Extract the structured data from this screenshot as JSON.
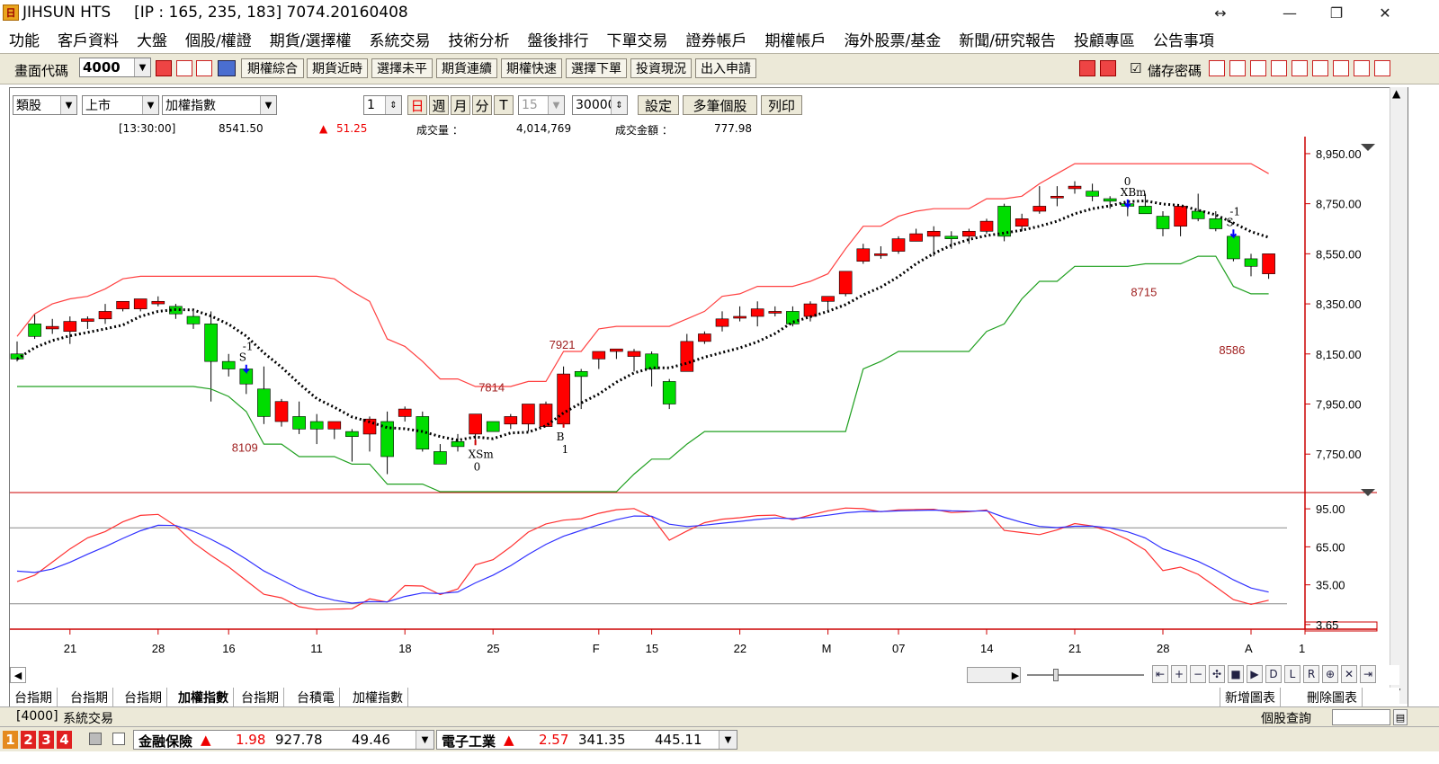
{
  "window": {
    "app_name": "JIHSUN HTS",
    "info": "[IP : 165, 235, 183] 7074.20160408",
    "logo_text": "日",
    "icons": {
      "resize": "↔",
      "minimize": "—",
      "restore": "❐",
      "close": "✕"
    }
  },
  "menu": [
    "功能",
    "客戶資料",
    "大盤",
    "個股/權證",
    "期貨/選擇權",
    "系統交易",
    "技術分析",
    "盤後排行",
    "下單交易",
    "證券帳戶",
    "期權帳戶",
    "海外股票/基金",
    "新聞/研究報告",
    "投顧專區",
    "公告事項"
  ],
  "toolbar": {
    "code_label": "畫面代碼",
    "code_value": "4000",
    "buttons": [
      "期權綜合",
      "期貨近時",
      "選擇未平",
      "期貨連續",
      "期權快速",
      "選擇下單",
      "投資現況",
      "出入申請"
    ],
    "save_pwd_label": "儲存密碼",
    "save_pwd_checked": "☑"
  },
  "controls": {
    "sel1": "類股",
    "sel2": "上市",
    "sel3": "加權指數",
    "num1": "1",
    "periods": [
      "日",
      "週",
      "月",
      "分",
      "T"
    ],
    "num2": "15",
    "num3": "30000",
    "btn_settings": "設定",
    "btn_multi": "多筆個股",
    "btn_print": "列印"
  },
  "info": {
    "time": "[13:30:00]",
    "price": "8541.50",
    "change": "51.25",
    "vol_label": "成交量 ：",
    "volume": "4,014,769",
    "amt_label": "成交金額 ：",
    "amount": "777.98"
  },
  "chart_data": {
    "type": "candlestick",
    "price_axis": {
      "ticks": [
        "8,950.00",
        "8,750.00",
        "8,550.00",
        "8,350.00",
        "8,150.00",
        "7,950.00",
        "7,750.00"
      ],
      "range": [
        7600,
        9000
      ]
    },
    "osc_axis": {
      "ticks": [
        "95.00",
        "65.00",
        "35.00",
        "3.65"
      ],
      "range": [
        0,
        105
      ]
    },
    "x_labels": [
      "21",
      "28",
      "16",
      "11",
      "18",
      "25",
      "F",
      "15",
      "22",
      "M",
      "07",
      "14",
      "21",
      "28",
      "A",
      "1"
    ],
    "candles": [
      [
        8150,
        8200,
        8120,
        8130
      ],
      [
        8270,
        8310,
        8210,
        8220
      ],
      [
        8250,
        8290,
        8230,
        8260
      ],
      [
        8240,
        8300,
        8190,
        8280
      ],
      [
        8280,
        8300,
        8250,
        8290
      ],
      [
        8290,
        8350,
        8270,
        8320
      ],
      [
        8330,
        8360,
        8320,
        8360
      ],
      [
        8330,
        8370,
        8320,
        8370
      ],
      [
        8350,
        8380,
        8340,
        8360
      ],
      [
        8340,
        8350,
        8290,
        8310
      ],
      [
        8300,
        8330,
        8250,
        8270
      ],
      [
        8270,
        8320,
        7960,
        8120
      ],
      [
        8120,
        8150,
        8060,
        8090
      ],
      [
        8090,
        8100,
        7990,
        8030
      ],
      [
        8010,
        8100,
        7870,
        7900
      ],
      [
        7880,
        7970,
        7860,
        7960
      ],
      [
        7900,
        7960,
        7830,
        7850
      ],
      [
        7880,
        7910,
        7790,
        7850
      ],
      [
        7850,
        7880,
        7810,
        7880
      ],
      [
        7840,
        7850,
        7720,
        7820
      ],
      [
        7830,
        7900,
        7760,
        7890
      ],
      [
        7880,
        7920,
        7670,
        7740
      ],
      [
        7900,
        7940,
        7880,
        7930
      ],
      [
        7900,
        7920,
        7760,
        7770
      ],
      [
        7760,
        7790,
        7720,
        7710
      ],
      [
        7800,
        7830,
        7760,
        7780
      ],
      [
        7830,
        7910,
        7800,
        7910
      ],
      [
        7880,
        7880,
        7850,
        7840
      ],
      [
        7870,
        7910,
        7850,
        7900
      ],
      [
        7870,
        7950,
        7840,
        7950
      ],
      [
        7860,
        7960,
        7860,
        7950
      ],
      [
        7870,
        8100,
        7870,
        8070
      ],
      [
        8080,
        8090,
        7930,
        8060
      ],
      [
        8130,
        8160,
        8090,
        8160
      ],
      [
        8160,
        8170,
        8130,
        8170
      ],
      [
        8140,
        8170,
        8080,
        8160
      ],
      [
        8150,
        8160,
        8020,
        8090
      ],
      [
        8040,
        8050,
        7930,
        7950
      ],
      [
        8080,
        8230,
        8080,
        8200
      ],
      [
        8200,
        8240,
        8190,
        8230
      ],
      [
        8260,
        8320,
        8240,
        8290
      ],
      [
        8300,
        8340,
        8280,
        8300
      ],
      [
        8300,
        8360,
        8260,
        8330
      ],
      [
        8320,
        8340,
        8300,
        8320
      ],
      [
        8320,
        8340,
        8260,
        8270
      ],
      [
        8300,
        8360,
        8280,
        8350
      ],
      [
        8360,
        8380,
        8320,
        8380
      ],
      [
        8390,
        8480,
        8380,
        8480
      ],
      [
        8520,
        8590,
        8510,
        8570
      ],
      [
        8550,
        8580,
        8530,
        8550
      ],
      [
        8560,
        8620,
        8550,
        8610
      ],
      [
        8600,
        8650,
        8600,
        8630
      ],
      [
        8620,
        8660,
        8540,
        8640
      ],
      [
        8620,
        8640,
        8570,
        8610
      ],
      [
        8620,
        8650,
        8590,
        8640
      ],
      [
        8640,
        8690,
        8630,
        8680
      ],
      [
        8740,
        8750,
        8600,
        8620
      ],
      [
        8660,
        8710,
        8640,
        8690
      ],
      [
        8720,
        8820,
        8710,
        8740
      ],
      [
        8780,
        8820,
        8740,
        8780
      ],
      [
        8810,
        8840,
        8790,
        8820
      ],
      [
        8800,
        8830,
        8760,
        8780
      ],
      [
        8770,
        8780,
        8730,
        8760
      ],
      [
        8750,
        8760,
        8700,
        8740
      ],
      [
        8740,
        8790,
        8720,
        8710
      ],
      [
        8700,
        8720,
        8620,
        8650
      ],
      [
        8660,
        8730,
        8620,
        8740
      ],
      [
        8720,
        8790,
        8680,
        8690
      ],
      [
        8690,
        8720,
        8640,
        8650
      ],
      [
        8620,
        8640,
        8520,
        8530
      ],
      [
        8530,
        8550,
        8460,
        8500
      ],
      [
        8470,
        8550,
        8450,
        8550
      ]
    ],
    "signals": [
      {
        "label": "S",
        "count": "-1"
      },
      {
        "label": "XSm",
        "count": "0"
      },
      {
        "label": "B",
        "count": "1"
      },
      {
        "label": "XBm",
        "count": "0"
      },
      {
        "label": "S",
        "count": "-1"
      }
    ],
    "annotations": [
      "8109",
      "7814",
      "7921",
      "8715",
      "8586"
    ]
  },
  "bottom": {
    "tabs": [
      "台指期",
      "台指期",
      "台指期",
      "加權指數",
      "台指期",
      "台積電",
      "加權指數"
    ],
    "add_chart": "新增圖表",
    "del_chart": "刪除圖表",
    "nav": [
      "⇤",
      "+",
      "−",
      "✣",
      "■",
      "▶",
      "D",
      "L",
      "R",
      "⊕",
      "✕",
      "⇥"
    ]
  },
  "status": {
    "code": "[4000]",
    "system": "系統交易",
    "query": "個股查詢",
    "tabs_nums": [
      "1",
      "2",
      "3",
      "4"
    ],
    "sector1": {
      "name": "金融保險",
      "change": "1.98",
      "price": "927.78",
      "value": "49.46"
    },
    "sector2": {
      "name": "電子工業",
      "change": "2.57",
      "price": "341.35",
      "value": "445.11"
    }
  },
  "colors": {
    "up": "#ff0000",
    "down": "#00dd00",
    "upper_band": "#ff4040",
    "lower_band": "#20a020",
    "ma": "#000000",
    "k": "#ff3030",
    "d": "#3030ff"
  }
}
